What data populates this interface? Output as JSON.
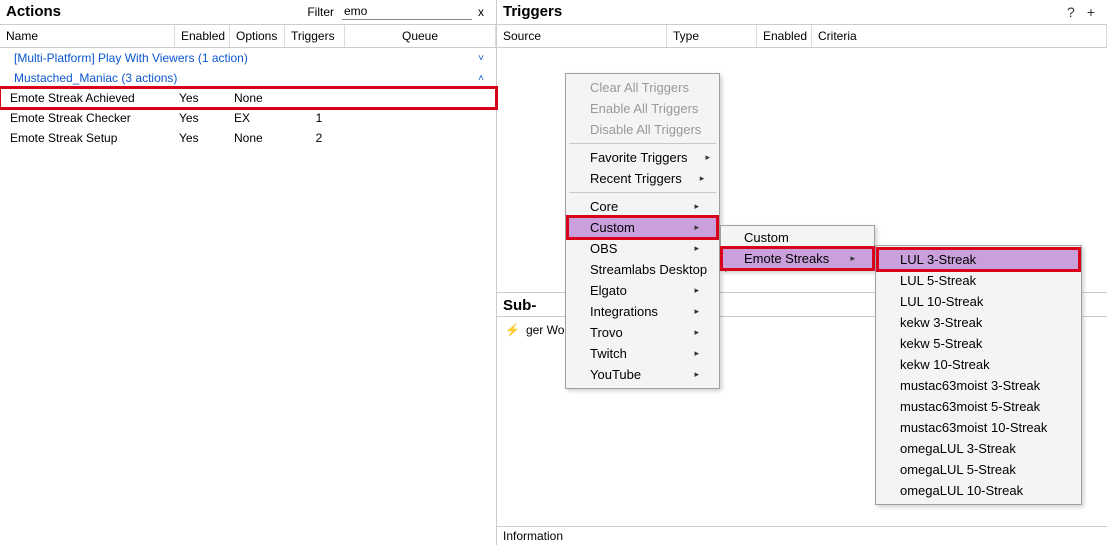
{
  "actions": {
    "title": "Actions",
    "filter_label": "Filter",
    "filter_value": "emo",
    "columns": {
      "name": "Name",
      "enabled": "Enabled",
      "options": "Options",
      "triggers": "Triggers",
      "queue": "Queue"
    },
    "groups": [
      {
        "label": "[Multi-Platform] Play With Viewers (1 action)",
        "expanded": false,
        "chev": "˅"
      },
      {
        "label": "Mustached_Maniac (3 actions)",
        "expanded": true,
        "chev": "˄"
      }
    ],
    "rows": [
      {
        "name": "Emote Streak Achieved",
        "enabled": "Yes",
        "options": "None",
        "triggers": "",
        "highlight": true
      },
      {
        "name": "Emote Streak Checker",
        "enabled": "Yes",
        "options": "EX",
        "triggers": "1",
        "highlight": false
      },
      {
        "name": "Emote Streak Setup",
        "enabled": "Yes",
        "options": "None",
        "triggers": "2",
        "highlight": false
      }
    ]
  },
  "triggers": {
    "title": "Triggers",
    "columns": {
      "source": "Source",
      "type": "Type",
      "enabled": "Enabled",
      "criteria": "Criteria"
    }
  },
  "sub": {
    "title": "Sub-",
    "partial_text": "ger Worked!)"
  },
  "information": {
    "title": "Information"
  },
  "menu_main": {
    "clear": "Clear All Triggers",
    "enable": "Enable All Triggers",
    "disable": "Disable All Triggers",
    "favorite": "Favorite Triggers",
    "recent": "Recent Triggers",
    "items": [
      {
        "label": "Core"
      },
      {
        "label": "Custom",
        "highlight": true
      },
      {
        "label": "OBS"
      },
      {
        "label": "Streamlabs Desktop"
      },
      {
        "label": "Elgato"
      },
      {
        "label": "Integrations"
      },
      {
        "label": "Trovo"
      },
      {
        "label": "Twitch"
      },
      {
        "label": "YouTube"
      }
    ]
  },
  "menu_sub1": {
    "items": [
      {
        "label": "Custom",
        "has_arrow": false
      },
      {
        "label": "Emote Streaks",
        "has_arrow": true,
        "highlight": true
      }
    ]
  },
  "menu_sub2": {
    "items": [
      {
        "label": "LUL 3-Streak",
        "highlight": true
      },
      {
        "label": "LUL 5-Streak"
      },
      {
        "label": "LUL 10-Streak"
      },
      {
        "label": "kekw 3-Streak"
      },
      {
        "label": "kekw 5-Streak"
      },
      {
        "label": "kekw 10-Streak"
      },
      {
        "label": "mustac63moist 3-Streak"
      },
      {
        "label": "mustac63moist 5-Streak"
      },
      {
        "label": "mustac63moist 10-Streak"
      },
      {
        "label": "omegaLUL 3-Streak"
      },
      {
        "label": "omegaLUL 5-Streak"
      },
      {
        "label": "omegaLUL 10-Streak"
      }
    ]
  },
  "glyph": {
    "arrow": "▸",
    "x": "x",
    "help": "?",
    "plus": "+"
  }
}
